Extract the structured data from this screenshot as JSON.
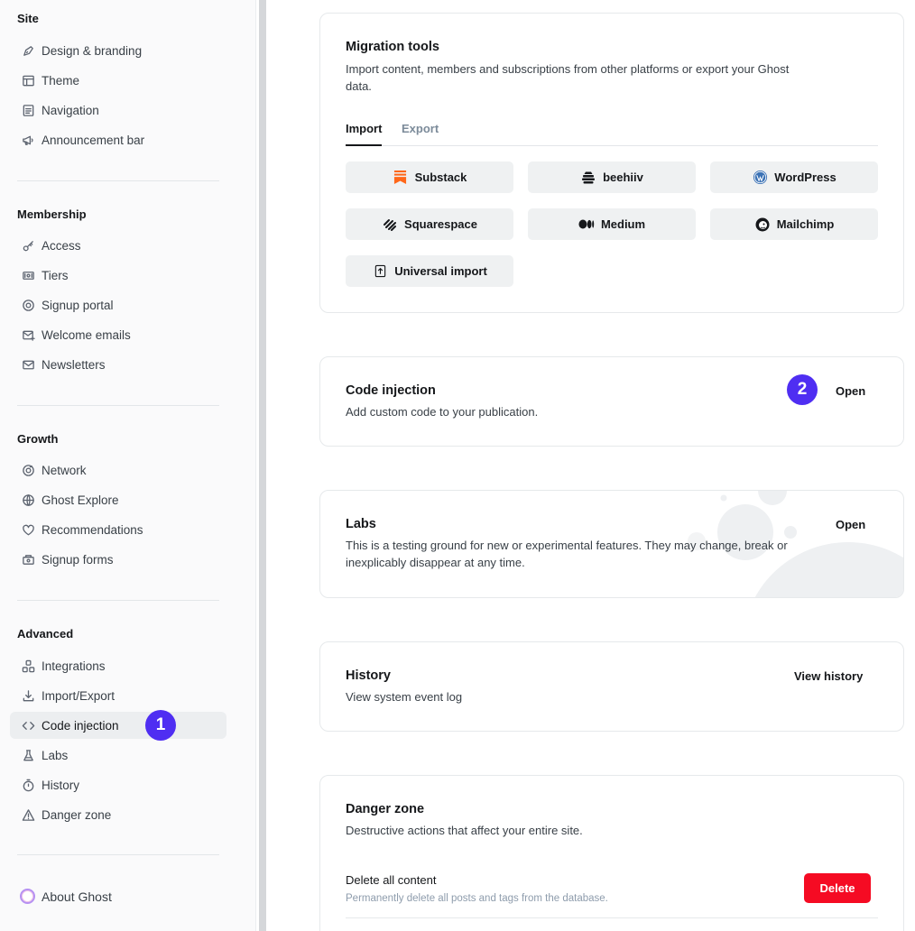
{
  "sidebar": {
    "sections": [
      {
        "title": "Site",
        "items": [
          "Design & branding",
          "Theme",
          "Navigation",
          "Announcement bar"
        ]
      },
      {
        "title": "Membership",
        "items": [
          "Access",
          "Tiers",
          "Signup portal",
          "Welcome emails",
          "Newsletters"
        ]
      },
      {
        "title": "Growth",
        "items": [
          "Network",
          "Ghost Explore",
          "Recommendations",
          "Signup forms"
        ]
      },
      {
        "title": "Advanced",
        "items": [
          "Integrations",
          "Import/Export",
          "Code injection",
          "Labs",
          "History",
          "Danger zone"
        ]
      }
    ],
    "active_item": "Code injection",
    "about": "About Ghost"
  },
  "badges": {
    "one": "1",
    "two": "2",
    "color": "#4f2ef2"
  },
  "migration": {
    "title": "Migration tools",
    "description": "Import content, members and subscriptions from other platforms or export your Ghost data.",
    "tabs": {
      "import": "Import",
      "export": "Export"
    },
    "buttons": [
      "Substack",
      "beehiiv",
      "WordPress",
      "Squarespace",
      "Medium",
      "Mailchimp",
      "Universal import"
    ]
  },
  "code_injection": {
    "title": "Code injection",
    "description": "Add custom code to your publication.",
    "action": "Open"
  },
  "labs": {
    "title": "Labs",
    "description": "This is a testing ground for new or experimental features. They may change, break or inexplicably disappear at any time.",
    "action": "Open"
  },
  "history": {
    "title": "History",
    "description": "View system event log",
    "action": "View history"
  },
  "danger": {
    "title": "Danger zone",
    "description": "Destructive actions that affect your entire site.",
    "delete_title": "Delete all content",
    "delete_desc": "Permanently delete all posts and tags from the database.",
    "delete_button": "Delete",
    "delete_color": "#f50b23"
  }
}
